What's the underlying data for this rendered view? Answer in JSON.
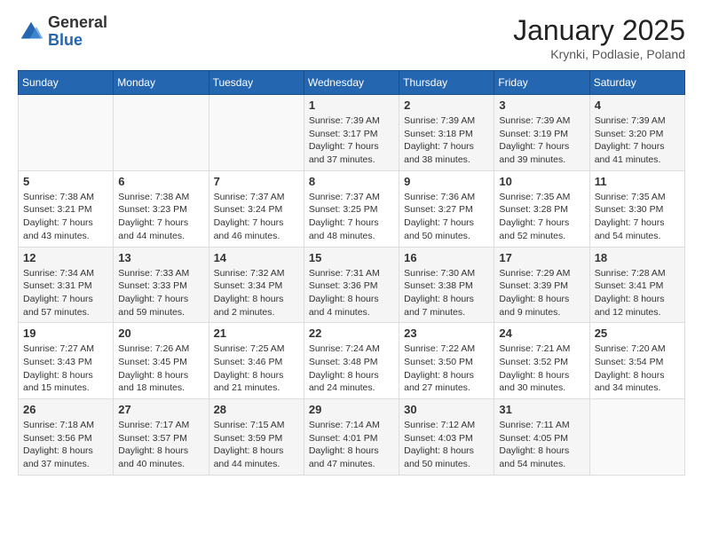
{
  "logo": {
    "general": "General",
    "blue": "Blue"
  },
  "header": {
    "month": "January 2025",
    "location": "Krynki, Podlasie, Poland"
  },
  "weekdays": [
    "Sunday",
    "Monday",
    "Tuesday",
    "Wednesday",
    "Thursday",
    "Friday",
    "Saturday"
  ],
  "weeks": [
    [
      {
        "day": "",
        "info": ""
      },
      {
        "day": "",
        "info": ""
      },
      {
        "day": "",
        "info": ""
      },
      {
        "day": "1",
        "info": "Sunrise: 7:39 AM\nSunset: 3:17 PM\nDaylight: 7 hours and 37 minutes."
      },
      {
        "day": "2",
        "info": "Sunrise: 7:39 AM\nSunset: 3:18 PM\nDaylight: 7 hours and 38 minutes."
      },
      {
        "day": "3",
        "info": "Sunrise: 7:39 AM\nSunset: 3:19 PM\nDaylight: 7 hours and 39 minutes."
      },
      {
        "day": "4",
        "info": "Sunrise: 7:39 AM\nSunset: 3:20 PM\nDaylight: 7 hours and 41 minutes."
      }
    ],
    [
      {
        "day": "5",
        "info": "Sunrise: 7:38 AM\nSunset: 3:21 PM\nDaylight: 7 hours and 43 minutes."
      },
      {
        "day": "6",
        "info": "Sunrise: 7:38 AM\nSunset: 3:23 PM\nDaylight: 7 hours and 44 minutes."
      },
      {
        "day": "7",
        "info": "Sunrise: 7:37 AM\nSunset: 3:24 PM\nDaylight: 7 hours and 46 minutes."
      },
      {
        "day": "8",
        "info": "Sunrise: 7:37 AM\nSunset: 3:25 PM\nDaylight: 7 hours and 48 minutes."
      },
      {
        "day": "9",
        "info": "Sunrise: 7:36 AM\nSunset: 3:27 PM\nDaylight: 7 hours and 50 minutes."
      },
      {
        "day": "10",
        "info": "Sunrise: 7:35 AM\nSunset: 3:28 PM\nDaylight: 7 hours and 52 minutes."
      },
      {
        "day": "11",
        "info": "Sunrise: 7:35 AM\nSunset: 3:30 PM\nDaylight: 7 hours and 54 minutes."
      }
    ],
    [
      {
        "day": "12",
        "info": "Sunrise: 7:34 AM\nSunset: 3:31 PM\nDaylight: 7 hours and 57 minutes."
      },
      {
        "day": "13",
        "info": "Sunrise: 7:33 AM\nSunset: 3:33 PM\nDaylight: 7 hours and 59 minutes."
      },
      {
        "day": "14",
        "info": "Sunrise: 7:32 AM\nSunset: 3:34 PM\nDaylight: 8 hours and 2 minutes."
      },
      {
        "day": "15",
        "info": "Sunrise: 7:31 AM\nSunset: 3:36 PM\nDaylight: 8 hours and 4 minutes."
      },
      {
        "day": "16",
        "info": "Sunrise: 7:30 AM\nSunset: 3:38 PM\nDaylight: 8 hours and 7 minutes."
      },
      {
        "day": "17",
        "info": "Sunrise: 7:29 AM\nSunset: 3:39 PM\nDaylight: 8 hours and 9 minutes."
      },
      {
        "day": "18",
        "info": "Sunrise: 7:28 AM\nSunset: 3:41 PM\nDaylight: 8 hours and 12 minutes."
      }
    ],
    [
      {
        "day": "19",
        "info": "Sunrise: 7:27 AM\nSunset: 3:43 PM\nDaylight: 8 hours and 15 minutes."
      },
      {
        "day": "20",
        "info": "Sunrise: 7:26 AM\nSunset: 3:45 PM\nDaylight: 8 hours and 18 minutes."
      },
      {
        "day": "21",
        "info": "Sunrise: 7:25 AM\nSunset: 3:46 PM\nDaylight: 8 hours and 21 minutes."
      },
      {
        "day": "22",
        "info": "Sunrise: 7:24 AM\nSunset: 3:48 PM\nDaylight: 8 hours and 24 minutes."
      },
      {
        "day": "23",
        "info": "Sunrise: 7:22 AM\nSunset: 3:50 PM\nDaylight: 8 hours and 27 minutes."
      },
      {
        "day": "24",
        "info": "Sunrise: 7:21 AM\nSunset: 3:52 PM\nDaylight: 8 hours and 30 minutes."
      },
      {
        "day": "25",
        "info": "Sunrise: 7:20 AM\nSunset: 3:54 PM\nDaylight: 8 hours and 34 minutes."
      }
    ],
    [
      {
        "day": "26",
        "info": "Sunrise: 7:18 AM\nSunset: 3:56 PM\nDaylight: 8 hours and 37 minutes."
      },
      {
        "day": "27",
        "info": "Sunrise: 7:17 AM\nSunset: 3:57 PM\nDaylight: 8 hours and 40 minutes."
      },
      {
        "day": "28",
        "info": "Sunrise: 7:15 AM\nSunset: 3:59 PM\nDaylight: 8 hours and 44 minutes."
      },
      {
        "day": "29",
        "info": "Sunrise: 7:14 AM\nSunset: 4:01 PM\nDaylight: 8 hours and 47 minutes."
      },
      {
        "day": "30",
        "info": "Sunrise: 7:12 AM\nSunset: 4:03 PM\nDaylight: 8 hours and 50 minutes."
      },
      {
        "day": "31",
        "info": "Sunrise: 7:11 AM\nSunset: 4:05 PM\nDaylight: 8 hours and 54 minutes."
      },
      {
        "day": "",
        "info": ""
      }
    ]
  ]
}
